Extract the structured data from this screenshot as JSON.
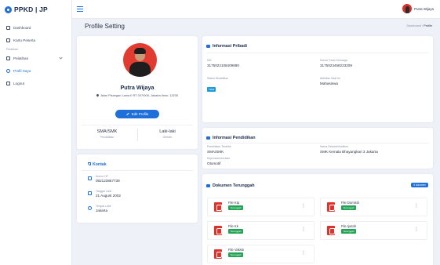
{
  "app": {
    "brand": "PPKD | JP"
  },
  "sidebar": {
    "items": [
      {
        "label": "Dashboard"
      },
      {
        "label": "Kartu Peserta"
      },
      {
        "label": "Pelatihan"
      },
      {
        "label": "Profil Saya"
      },
      {
        "label": "Logout"
      }
    ],
    "section_label": "Pelatihan"
  },
  "topbar": {
    "user_name": "Putra Wijaya"
  },
  "page": {
    "title": "Profile Setting",
    "breadcrumb": {
      "home": "Dashboard",
      "sep": "/",
      "current": "Profile"
    }
  },
  "profile": {
    "name": "Putra Wijaya",
    "address": "Jalan Pisangan Lama II RT 007/008, Jakarta timur, 13230",
    "edit_label": "Edit Profile",
    "education": {
      "value": "SMA/SMK",
      "label": "Pendidikan"
    },
    "gender": {
      "value": "Laki-laki",
      "label": "Gender"
    }
  },
  "kontak": {
    "title": "Kontak",
    "rows": [
      {
        "label": "Nomor HP",
        "value": "082123867739"
      },
      {
        "label": "Tanggal Lahir",
        "value": "21 August 2002"
      },
      {
        "label": "Tempat Lahir",
        "value": "Jakarta"
      }
    ]
  },
  "pribadi": {
    "title": "Informasi Pribadi",
    "nik": {
      "label": "NIK",
      "value": "3175022108409890"
    },
    "kk": {
      "label": "Nomor Kartu Keluarga",
      "value": "3175023458223209"
    },
    "status": {
      "label": "Status Disabilitas",
      "value": "Tidak"
    },
    "aktivitas": {
      "label": "Aktivitas Saat Ini",
      "value": "Mahasiswa"
    }
  },
  "pendidikan": {
    "title": "Informasi Pendidikan",
    "terakhir": {
      "label": "Pendidikan Terakhir",
      "value": "SMA/SMK"
    },
    "sekolah": {
      "label": "Nama Sekolah/Institusi",
      "value": "SMK Kemala Bhayangkari 3 Jakarta"
    },
    "jurusan": {
      "label": "Keprosian/Jurusan",
      "value": "Otomotif"
    }
  },
  "dokumen": {
    "title": "Dokumen Terunggah",
    "badge": "5 dokumen",
    "files": [
      {
        "name": "File Ktp",
        "status": "Terunggah"
      },
      {
        "name": "File Domisili",
        "status": "Terunggah"
      },
      {
        "name": "File Kk",
        "status": "Terunggah"
      },
      {
        "name": "File Ijazah",
        "status": "Terunggah"
      },
      {
        "name": "File Vaksin",
        "status": "Terunggah"
      }
    ],
    "menu_glyph": "⋮"
  },
  "colors": {
    "accent": "#1e6fd9",
    "success": "#23a455",
    "danger": "#e0322b",
    "background": "#eef1f7"
  },
  "icons": [
    "dashboard-icon",
    "card-icon",
    "book-icon",
    "user-icon",
    "logout-icon",
    "map-pin-icon",
    "phone-icon",
    "calendar-icon",
    "pdf-icon",
    "hamburger-icon"
  ]
}
